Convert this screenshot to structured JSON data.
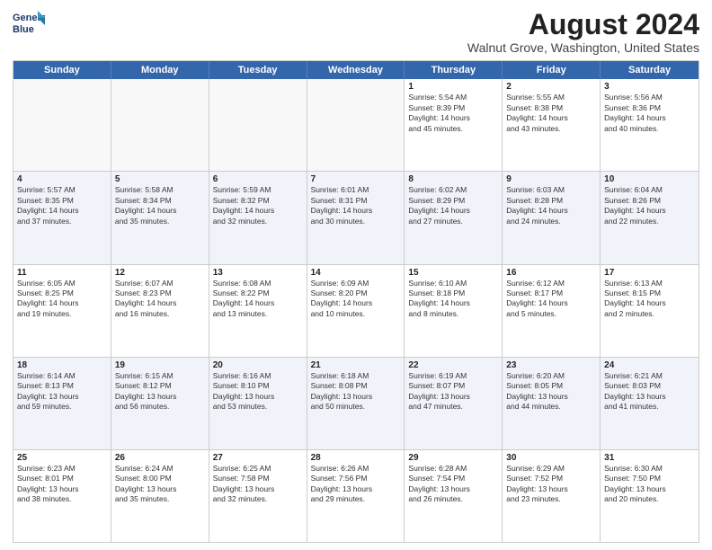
{
  "logo": {
    "line1": "General",
    "line2": "Blue"
  },
  "title": "August 2024",
  "location": "Walnut Grove, Washington, United States",
  "weekdays": [
    "Sunday",
    "Monday",
    "Tuesday",
    "Wednesday",
    "Thursday",
    "Friday",
    "Saturday"
  ],
  "rows": [
    [
      {
        "day": "",
        "text": "",
        "empty": true
      },
      {
        "day": "",
        "text": "",
        "empty": true
      },
      {
        "day": "",
        "text": "",
        "empty": true
      },
      {
        "day": "",
        "text": "",
        "empty": true
      },
      {
        "day": "1",
        "text": "Sunrise: 5:54 AM\nSunset: 8:39 PM\nDaylight: 14 hours\nand 45 minutes.",
        "empty": false
      },
      {
        "day": "2",
        "text": "Sunrise: 5:55 AM\nSunset: 8:38 PM\nDaylight: 14 hours\nand 43 minutes.",
        "empty": false
      },
      {
        "day": "3",
        "text": "Sunrise: 5:56 AM\nSunset: 8:36 PM\nDaylight: 14 hours\nand 40 minutes.",
        "empty": false
      }
    ],
    [
      {
        "day": "4",
        "text": "Sunrise: 5:57 AM\nSunset: 8:35 PM\nDaylight: 14 hours\nand 37 minutes.",
        "empty": false
      },
      {
        "day": "5",
        "text": "Sunrise: 5:58 AM\nSunset: 8:34 PM\nDaylight: 14 hours\nand 35 minutes.",
        "empty": false
      },
      {
        "day": "6",
        "text": "Sunrise: 5:59 AM\nSunset: 8:32 PM\nDaylight: 14 hours\nand 32 minutes.",
        "empty": false
      },
      {
        "day": "7",
        "text": "Sunrise: 6:01 AM\nSunset: 8:31 PM\nDaylight: 14 hours\nand 30 minutes.",
        "empty": false
      },
      {
        "day": "8",
        "text": "Sunrise: 6:02 AM\nSunset: 8:29 PM\nDaylight: 14 hours\nand 27 minutes.",
        "empty": false
      },
      {
        "day": "9",
        "text": "Sunrise: 6:03 AM\nSunset: 8:28 PM\nDaylight: 14 hours\nand 24 minutes.",
        "empty": false
      },
      {
        "day": "10",
        "text": "Sunrise: 6:04 AM\nSunset: 8:26 PM\nDaylight: 14 hours\nand 22 minutes.",
        "empty": false
      }
    ],
    [
      {
        "day": "11",
        "text": "Sunrise: 6:05 AM\nSunset: 8:25 PM\nDaylight: 14 hours\nand 19 minutes.",
        "empty": false
      },
      {
        "day": "12",
        "text": "Sunrise: 6:07 AM\nSunset: 8:23 PM\nDaylight: 14 hours\nand 16 minutes.",
        "empty": false
      },
      {
        "day": "13",
        "text": "Sunrise: 6:08 AM\nSunset: 8:22 PM\nDaylight: 14 hours\nand 13 minutes.",
        "empty": false
      },
      {
        "day": "14",
        "text": "Sunrise: 6:09 AM\nSunset: 8:20 PM\nDaylight: 14 hours\nand 10 minutes.",
        "empty": false
      },
      {
        "day": "15",
        "text": "Sunrise: 6:10 AM\nSunset: 8:18 PM\nDaylight: 14 hours\nand 8 minutes.",
        "empty": false
      },
      {
        "day": "16",
        "text": "Sunrise: 6:12 AM\nSunset: 8:17 PM\nDaylight: 14 hours\nand 5 minutes.",
        "empty": false
      },
      {
        "day": "17",
        "text": "Sunrise: 6:13 AM\nSunset: 8:15 PM\nDaylight: 14 hours\nand 2 minutes.",
        "empty": false
      }
    ],
    [
      {
        "day": "18",
        "text": "Sunrise: 6:14 AM\nSunset: 8:13 PM\nDaylight: 13 hours\nand 59 minutes.",
        "empty": false
      },
      {
        "day": "19",
        "text": "Sunrise: 6:15 AM\nSunset: 8:12 PM\nDaylight: 13 hours\nand 56 minutes.",
        "empty": false
      },
      {
        "day": "20",
        "text": "Sunrise: 6:16 AM\nSunset: 8:10 PM\nDaylight: 13 hours\nand 53 minutes.",
        "empty": false
      },
      {
        "day": "21",
        "text": "Sunrise: 6:18 AM\nSunset: 8:08 PM\nDaylight: 13 hours\nand 50 minutes.",
        "empty": false
      },
      {
        "day": "22",
        "text": "Sunrise: 6:19 AM\nSunset: 8:07 PM\nDaylight: 13 hours\nand 47 minutes.",
        "empty": false
      },
      {
        "day": "23",
        "text": "Sunrise: 6:20 AM\nSunset: 8:05 PM\nDaylight: 13 hours\nand 44 minutes.",
        "empty": false
      },
      {
        "day": "24",
        "text": "Sunrise: 6:21 AM\nSunset: 8:03 PM\nDaylight: 13 hours\nand 41 minutes.",
        "empty": false
      }
    ],
    [
      {
        "day": "25",
        "text": "Sunrise: 6:23 AM\nSunset: 8:01 PM\nDaylight: 13 hours\nand 38 minutes.",
        "empty": false
      },
      {
        "day": "26",
        "text": "Sunrise: 6:24 AM\nSunset: 8:00 PM\nDaylight: 13 hours\nand 35 minutes.",
        "empty": false
      },
      {
        "day": "27",
        "text": "Sunrise: 6:25 AM\nSunset: 7:58 PM\nDaylight: 13 hours\nand 32 minutes.",
        "empty": false
      },
      {
        "day": "28",
        "text": "Sunrise: 6:26 AM\nSunset: 7:56 PM\nDaylight: 13 hours\nand 29 minutes.",
        "empty": false
      },
      {
        "day": "29",
        "text": "Sunrise: 6:28 AM\nSunset: 7:54 PM\nDaylight: 13 hours\nand 26 minutes.",
        "empty": false
      },
      {
        "day": "30",
        "text": "Sunrise: 6:29 AM\nSunset: 7:52 PM\nDaylight: 13 hours\nand 23 minutes.",
        "empty": false
      },
      {
        "day": "31",
        "text": "Sunrise: 6:30 AM\nSunset: 7:50 PM\nDaylight: 13 hours\nand 20 minutes.",
        "empty": false
      }
    ]
  ],
  "alt_rows": [
    1,
    3
  ]
}
